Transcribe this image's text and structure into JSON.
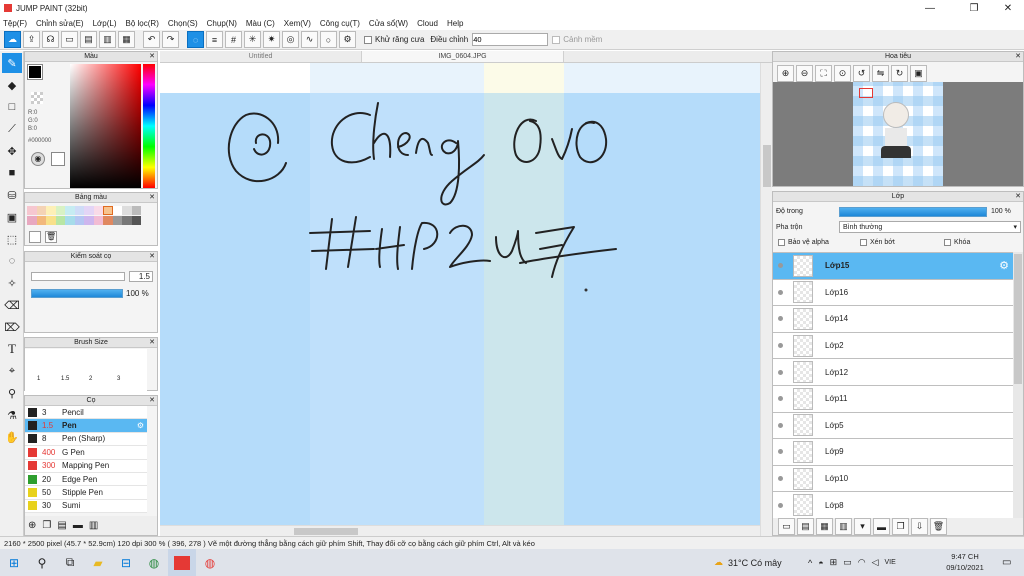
{
  "window": {
    "title": "JUMP PAINT (32bit)",
    "minimize": "—",
    "maximize": "❐",
    "close": "✕"
  },
  "menu": [
    "Tệp(F)",
    "Chỉnh sửa(E)",
    "Lớp(L)",
    "Bộ lọc(R)",
    "Chọn(S)",
    "Chụp(N)",
    "Màu (C)",
    "Xem(V)",
    "Công cụ(T)",
    "Cửa sổ(W)",
    "Cloud",
    "Help"
  ],
  "toolbar": {
    "antialias_label": "Khử răng cưa",
    "adjust_label": "Điều chỉnh",
    "adjust_value": "40",
    "warning_label": "Cảnh mềm"
  },
  "color_panel": {
    "title": "Màu",
    "r": "R:0",
    "g": "G:0",
    "b": "B:0",
    "hex": "#000000",
    "fg": "#000000"
  },
  "palette": {
    "title": "Bảng màu"
  },
  "brush_control": {
    "title": "Kiểm soát cọ",
    "size_value": "1.5",
    "opacity_value": "100 %"
  },
  "brush_size": {
    "title": "Brush Size",
    "sizes": [
      "1",
      "1.5",
      "2",
      "3"
    ]
  },
  "brushes": {
    "title": "Cọ",
    "items": [
      {
        "size": "3",
        "name": "Pencil",
        "color": "#222222"
      },
      {
        "size": "1.5",
        "name": "Pen",
        "color": "#222222"
      },
      {
        "size": "8",
        "name": "Pen (Sharp)",
        "color": "#222222"
      },
      {
        "size": "400",
        "name": "G Pen",
        "color": "#e53935"
      },
      {
        "size": "300",
        "name": "Mapping Pen",
        "color": "#e53935"
      },
      {
        "size": "20",
        "name": "Edge Pen",
        "color": "#2e9e2e"
      },
      {
        "size": "50",
        "name": "Stipple Pen",
        "color": "#e8d21c"
      },
      {
        "size": "30",
        "name": "Sumi",
        "color": "#e8d21c"
      }
    ]
  },
  "tabs": [
    "Untitled",
    "IMG_0604.JPG"
  ],
  "canvas": {
    "line1": "@ Cheng OvO",
    "line2": "#HP2u7"
  },
  "navigator": {
    "title": "Hoa tiêu"
  },
  "layers": {
    "title": "Lớp",
    "opacity_label": "Độ trong",
    "opacity_value": "100 %",
    "blend_label": "Pha trộn",
    "blend_value": "Bình thường",
    "protect_alpha": "Bảo vệ alpha",
    "clip": "Xén bớt",
    "lock": "Khóa",
    "items": [
      "Lớp15",
      "Lớp16",
      "Lớp14",
      "Lớp2",
      "Lớp12",
      "Lớp11",
      "Lớp5",
      "Lớp9",
      "Lớp10",
      "Lớp8"
    ]
  },
  "status": {
    "text": "2160 * 2500 pixel   (45.7 * 52.9cm)   120 dpi   300 %   ( 396, 278 )   Vẽ một đường thẳng bằng cách giữ phím Shift, Thay đổi cỡ cọ bằng cách giữ phím Ctrl, Alt và kéo"
  },
  "taskbar": {
    "weather": "31°C  Có mây",
    "lang": "VIE",
    "time": "9:47 CH",
    "date": "09/10/2021"
  }
}
